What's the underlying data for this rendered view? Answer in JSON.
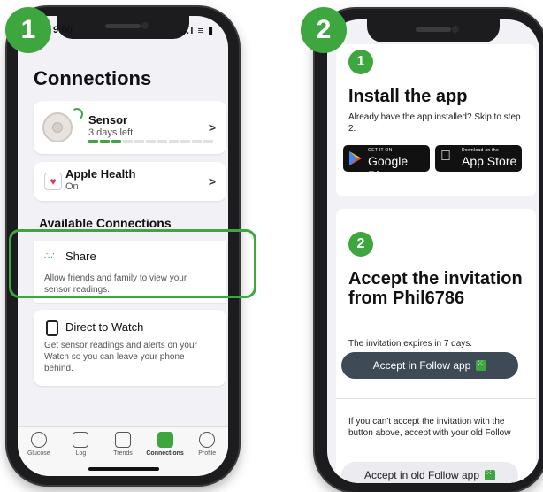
{
  "steps": {
    "left": "1",
    "right": "2"
  },
  "left_phone": {
    "status_time": "9:00",
    "status_icons": "…l ≡ ▮",
    "title": "Connections",
    "sensor": {
      "title": "Sensor",
      "subtitle": "3 days left",
      "progress_segments": {
        "filled": 3,
        "total": 11
      }
    },
    "apple_health": {
      "title": "Apple Health",
      "subtitle": "On",
      "icon": "heart-icon"
    },
    "available_heading": "Available Connections",
    "share": {
      "title": "Share",
      "desc": "Allow friends and family to view your sensor readings.",
      "icon": "share-dots-icon"
    },
    "watch": {
      "title": "Direct to Watch",
      "desc": "Get sensor readings and alerts on your Watch so you can leave your phone behind.",
      "icon": "watch-icon"
    },
    "chevron": ">",
    "tabs": [
      {
        "label": "Glucose",
        "icon": "glucose-icon"
      },
      {
        "label": "Log",
        "icon": "log-icon"
      },
      {
        "label": "Trends",
        "icon": "trends-icon"
      },
      {
        "label": "Connections",
        "icon": "connections-icon",
        "active": true
      },
      {
        "label": "Profile",
        "icon": "profile-icon"
      }
    ]
  },
  "right_phone": {
    "install": {
      "number": "1",
      "title": "Install the app",
      "desc": "Already have the app installed? Skip to step 2.",
      "google": {
        "small": "GET IT ON",
        "big": "Google Play"
      },
      "apple": {
        "small": "Download on the",
        "big": "App Store"
      }
    },
    "accept": {
      "number": "2",
      "title": "Accept the invitation from Phil6786",
      "expires": "The invitation expires in 7 days.",
      "primary_button": "Accept in Follow app",
      "fallback_text": "If you can't accept the invitation with the button above, accept with your old Follow",
      "secondary_button": "Accept in old Follow app"
    }
  },
  "colors": {
    "brand_green": "#3ea63f",
    "dark_button": "#3e4a56",
    "heart": "#e8345a"
  }
}
